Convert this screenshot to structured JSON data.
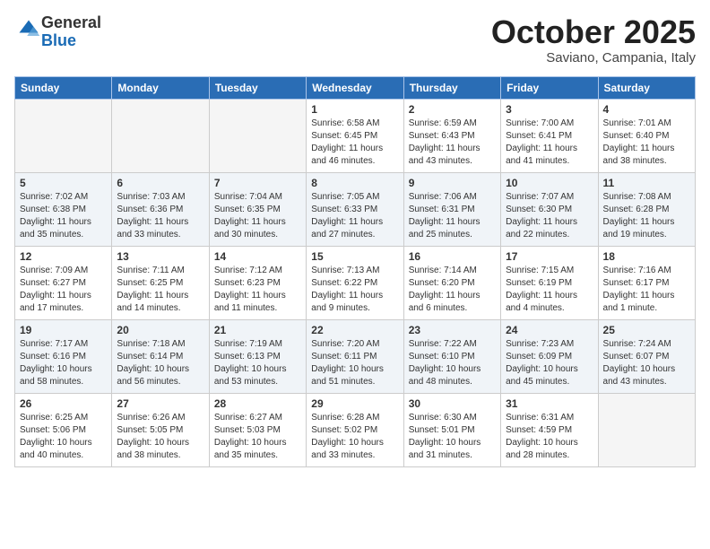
{
  "logo": {
    "general": "General",
    "blue": "Blue"
  },
  "header": {
    "month": "October 2025",
    "location": "Saviano, Campania, Italy"
  },
  "weekdays": [
    "Sunday",
    "Monday",
    "Tuesday",
    "Wednesday",
    "Thursday",
    "Friday",
    "Saturday"
  ],
  "weeks": [
    [
      {
        "num": "",
        "info": ""
      },
      {
        "num": "",
        "info": ""
      },
      {
        "num": "",
        "info": ""
      },
      {
        "num": "1",
        "info": "Sunrise: 6:58 AM\nSunset: 6:45 PM\nDaylight: 11 hours\nand 46 minutes."
      },
      {
        "num": "2",
        "info": "Sunrise: 6:59 AM\nSunset: 6:43 PM\nDaylight: 11 hours\nand 43 minutes."
      },
      {
        "num": "3",
        "info": "Sunrise: 7:00 AM\nSunset: 6:41 PM\nDaylight: 11 hours\nand 41 minutes."
      },
      {
        "num": "4",
        "info": "Sunrise: 7:01 AM\nSunset: 6:40 PM\nDaylight: 11 hours\nand 38 minutes."
      }
    ],
    [
      {
        "num": "5",
        "info": "Sunrise: 7:02 AM\nSunset: 6:38 PM\nDaylight: 11 hours\nand 35 minutes."
      },
      {
        "num": "6",
        "info": "Sunrise: 7:03 AM\nSunset: 6:36 PM\nDaylight: 11 hours\nand 33 minutes."
      },
      {
        "num": "7",
        "info": "Sunrise: 7:04 AM\nSunset: 6:35 PM\nDaylight: 11 hours\nand 30 minutes."
      },
      {
        "num": "8",
        "info": "Sunrise: 7:05 AM\nSunset: 6:33 PM\nDaylight: 11 hours\nand 27 minutes."
      },
      {
        "num": "9",
        "info": "Sunrise: 7:06 AM\nSunset: 6:31 PM\nDaylight: 11 hours\nand 25 minutes."
      },
      {
        "num": "10",
        "info": "Sunrise: 7:07 AM\nSunset: 6:30 PM\nDaylight: 11 hours\nand 22 minutes."
      },
      {
        "num": "11",
        "info": "Sunrise: 7:08 AM\nSunset: 6:28 PM\nDaylight: 11 hours\nand 19 minutes."
      }
    ],
    [
      {
        "num": "12",
        "info": "Sunrise: 7:09 AM\nSunset: 6:27 PM\nDaylight: 11 hours\nand 17 minutes."
      },
      {
        "num": "13",
        "info": "Sunrise: 7:11 AM\nSunset: 6:25 PM\nDaylight: 11 hours\nand 14 minutes."
      },
      {
        "num": "14",
        "info": "Sunrise: 7:12 AM\nSunset: 6:23 PM\nDaylight: 11 hours\nand 11 minutes."
      },
      {
        "num": "15",
        "info": "Sunrise: 7:13 AM\nSunset: 6:22 PM\nDaylight: 11 hours\nand 9 minutes."
      },
      {
        "num": "16",
        "info": "Sunrise: 7:14 AM\nSunset: 6:20 PM\nDaylight: 11 hours\nand 6 minutes."
      },
      {
        "num": "17",
        "info": "Sunrise: 7:15 AM\nSunset: 6:19 PM\nDaylight: 11 hours\nand 4 minutes."
      },
      {
        "num": "18",
        "info": "Sunrise: 7:16 AM\nSunset: 6:17 PM\nDaylight: 11 hours\nand 1 minute."
      }
    ],
    [
      {
        "num": "19",
        "info": "Sunrise: 7:17 AM\nSunset: 6:16 PM\nDaylight: 10 hours\nand 58 minutes."
      },
      {
        "num": "20",
        "info": "Sunrise: 7:18 AM\nSunset: 6:14 PM\nDaylight: 10 hours\nand 56 minutes."
      },
      {
        "num": "21",
        "info": "Sunrise: 7:19 AM\nSunset: 6:13 PM\nDaylight: 10 hours\nand 53 minutes."
      },
      {
        "num": "22",
        "info": "Sunrise: 7:20 AM\nSunset: 6:11 PM\nDaylight: 10 hours\nand 51 minutes."
      },
      {
        "num": "23",
        "info": "Sunrise: 7:22 AM\nSunset: 6:10 PM\nDaylight: 10 hours\nand 48 minutes."
      },
      {
        "num": "24",
        "info": "Sunrise: 7:23 AM\nSunset: 6:09 PM\nDaylight: 10 hours\nand 45 minutes."
      },
      {
        "num": "25",
        "info": "Sunrise: 7:24 AM\nSunset: 6:07 PM\nDaylight: 10 hours\nand 43 minutes."
      }
    ],
    [
      {
        "num": "26",
        "info": "Sunrise: 6:25 AM\nSunset: 5:06 PM\nDaylight: 10 hours\nand 40 minutes."
      },
      {
        "num": "27",
        "info": "Sunrise: 6:26 AM\nSunset: 5:05 PM\nDaylight: 10 hours\nand 38 minutes."
      },
      {
        "num": "28",
        "info": "Sunrise: 6:27 AM\nSunset: 5:03 PM\nDaylight: 10 hours\nand 35 minutes."
      },
      {
        "num": "29",
        "info": "Sunrise: 6:28 AM\nSunset: 5:02 PM\nDaylight: 10 hours\nand 33 minutes."
      },
      {
        "num": "30",
        "info": "Sunrise: 6:30 AM\nSunset: 5:01 PM\nDaylight: 10 hours\nand 31 minutes."
      },
      {
        "num": "31",
        "info": "Sunrise: 6:31 AM\nSunset: 4:59 PM\nDaylight: 10 hours\nand 28 minutes."
      },
      {
        "num": "",
        "info": ""
      }
    ]
  ]
}
